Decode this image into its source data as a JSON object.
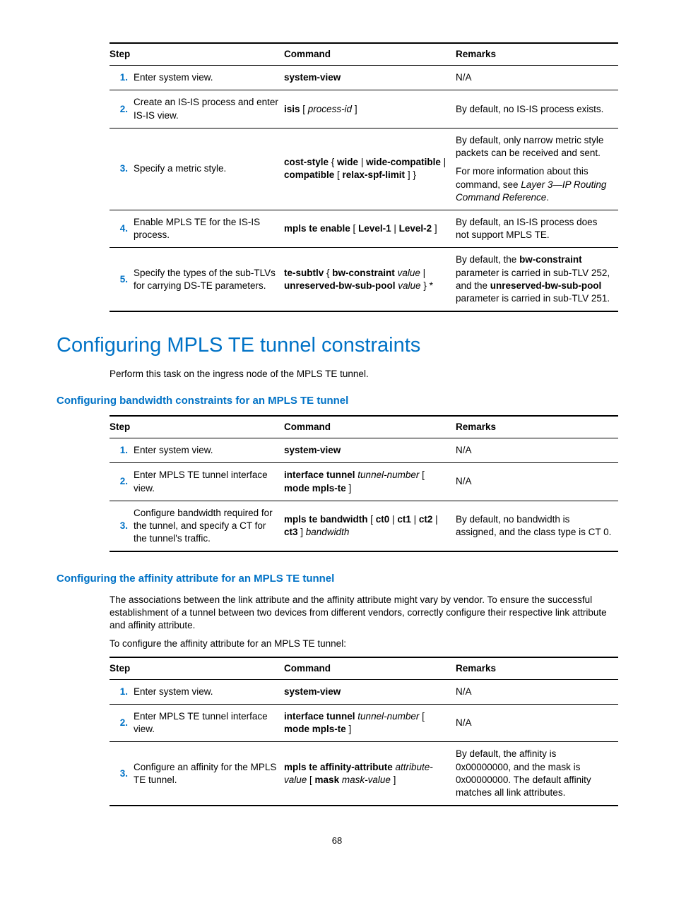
{
  "table1": {
    "headers": {
      "step": "Step",
      "command": "Command",
      "remarks": "Remarks"
    },
    "rows": [
      {
        "num": "1.",
        "step": "Enter system view.",
        "cmd": [
          {
            "t": "b",
            "v": "system-view"
          }
        ],
        "rem": [
          [
            {
              "t": "",
              "v": "N/A"
            }
          ]
        ]
      },
      {
        "num": "2.",
        "step": "Create an IS-IS process and enter IS-IS view.",
        "cmd": [
          {
            "t": "b",
            "v": "isis"
          },
          {
            "t": "",
            "v": " [ "
          },
          {
            "t": "i",
            "v": "process-id"
          },
          {
            "t": "",
            "v": " ]"
          }
        ],
        "rem": [
          [
            {
              "t": "",
              "v": "By default, no IS-IS process exists."
            }
          ]
        ]
      },
      {
        "num": "3.",
        "step": "Specify a metric style.",
        "cmd": [
          {
            "t": "b",
            "v": "cost-style"
          },
          {
            "t": "",
            "v": " { "
          },
          {
            "t": "b",
            "v": "wide"
          },
          {
            "t": "",
            "v": " | "
          },
          {
            "t": "b",
            "v": "wide-compatible"
          },
          {
            "t": "",
            "v": " | "
          },
          {
            "t": "b",
            "v": "compatible"
          },
          {
            "t": "",
            "v": " [ "
          },
          {
            "t": "b",
            "v": "relax-spf-limit"
          },
          {
            "t": "",
            "v": " ] }"
          }
        ],
        "rem": [
          [
            {
              "t": "",
              "v": "By default, only narrow metric style packets can be received and sent."
            }
          ],
          [
            {
              "t": "",
              "v": "For more information about this command, see "
            },
            {
              "t": "i",
              "v": "Layer 3—IP Routing Command Reference"
            },
            {
              "t": "",
              "v": "."
            }
          ]
        ]
      },
      {
        "num": "4.",
        "step": "Enable MPLS TE for the IS-IS process.",
        "cmd": [
          {
            "t": "b",
            "v": "mpls te enable"
          },
          {
            "t": "",
            "v": " [ "
          },
          {
            "t": "b",
            "v": "Level-1"
          },
          {
            "t": "",
            "v": " | "
          },
          {
            "t": "b",
            "v": "Level-2"
          },
          {
            "t": "",
            "v": " ]"
          }
        ],
        "rem": [
          [
            {
              "t": "",
              "v": "By default, an IS-IS process does not support MPLS TE."
            }
          ]
        ]
      },
      {
        "num": "5.",
        "step": "Specify the types of the sub-TLVs for carrying DS-TE parameters.",
        "cmd": [
          {
            "t": "b",
            "v": "te-subtlv"
          },
          {
            "t": "",
            "v": " { "
          },
          {
            "t": "b",
            "v": "bw-constraint"
          },
          {
            "t": "",
            "v": " "
          },
          {
            "t": "i",
            "v": "value"
          },
          {
            "t": "",
            "v": " | "
          },
          {
            "t": "b",
            "v": "unreserved-bw-sub-pool"
          },
          {
            "t": "",
            "v": " "
          },
          {
            "t": "i",
            "v": "value"
          },
          {
            "t": "",
            "v": " } *"
          }
        ],
        "rem": [
          [
            {
              "t": "",
              "v": "By default, the "
            },
            {
              "t": "b",
              "v": "bw-constraint"
            },
            {
              "t": "",
              "v": " parameter is carried in sub-TLV 252, and the "
            },
            {
              "t": "b",
              "v": "unreserved-bw-sub-pool"
            },
            {
              "t": "",
              "v": " parameter is carried in sub-TLV 251."
            }
          ]
        ]
      }
    ]
  },
  "h1": "Configuring MPLS TE tunnel constraints",
  "p1": "Perform this task on the ingress node of the MPLS TE tunnel.",
  "h2a": "Configuring bandwidth constraints for an MPLS TE tunnel",
  "table2": {
    "headers": {
      "step": "Step",
      "command": "Command",
      "remarks": "Remarks"
    },
    "rows": [
      {
        "num": "1.",
        "step": "Enter system view.",
        "cmd": [
          {
            "t": "b",
            "v": "system-view"
          }
        ],
        "rem": [
          [
            {
              "t": "",
              "v": "N/A"
            }
          ]
        ]
      },
      {
        "num": "2.",
        "step": "Enter MPLS TE tunnel interface view.",
        "cmd": [
          {
            "t": "b",
            "v": "interface tunnel"
          },
          {
            "t": "",
            "v": " "
          },
          {
            "t": "i",
            "v": "tunnel-number"
          },
          {
            "t": "",
            "v": " [ "
          },
          {
            "t": "b",
            "v": "mode mpls-te"
          },
          {
            "t": "",
            "v": " ]"
          }
        ],
        "rem": [
          [
            {
              "t": "",
              "v": "N/A"
            }
          ]
        ]
      },
      {
        "num": "3.",
        "step": "Configure bandwidth required for the tunnel, and specify a CT for the tunnel's traffic.",
        "cmd": [
          {
            "t": "b",
            "v": "mpls te bandwidth"
          },
          {
            "t": "",
            "v": " [ "
          },
          {
            "t": "b",
            "v": "ct0"
          },
          {
            "t": "",
            "v": " | "
          },
          {
            "t": "b",
            "v": "ct1"
          },
          {
            "t": "",
            "v": " | "
          },
          {
            "t": "b",
            "v": "ct2"
          },
          {
            "t": "",
            "v": " | "
          },
          {
            "t": "b",
            "v": "ct3"
          },
          {
            "t": "",
            "v": " ] "
          },
          {
            "t": "i",
            "v": "bandwidth"
          }
        ],
        "rem": [
          [
            {
              "t": "",
              "v": "By default, no bandwidth is assigned, and the class type is CT 0."
            }
          ]
        ]
      }
    ]
  },
  "h2b": "Configuring the affinity attribute for an MPLS TE tunnel",
  "p2": "The associations between the link attribute and the affinity attribute might vary by vendor. To ensure the successful establishment of a tunnel between two devices from different vendors, correctly configure their respective link attribute and affinity attribute.",
  "p3": "To configure the affinity attribute for an MPLS TE tunnel:",
  "table3": {
    "headers": {
      "step": "Step",
      "command": "Command",
      "remarks": "Remarks"
    },
    "rows": [
      {
        "num": "1.",
        "step": "Enter system view.",
        "cmd": [
          {
            "t": "b",
            "v": "system-view"
          }
        ],
        "rem": [
          [
            {
              "t": "",
              "v": "N/A"
            }
          ]
        ]
      },
      {
        "num": "2.",
        "step": "Enter MPLS TE tunnel interface view.",
        "cmd": [
          {
            "t": "b",
            "v": "interface tunnel"
          },
          {
            "t": "",
            "v": " "
          },
          {
            "t": "i",
            "v": "tunnel-number"
          },
          {
            "t": "",
            "v": " [ "
          },
          {
            "t": "b",
            "v": "mode mpls-te"
          },
          {
            "t": "",
            "v": " ]"
          }
        ],
        "rem": [
          [
            {
              "t": "",
              "v": "N/A"
            }
          ]
        ]
      },
      {
        "num": "3.",
        "step": "Configure an affinity for the MPLS TE tunnel.",
        "cmd": [
          {
            "t": "b",
            "v": "mpls te affinity-attribute"
          },
          {
            "t": "",
            "v": " "
          },
          {
            "t": "i",
            "v": "attribute-value"
          },
          {
            "t": "",
            "v": " [ "
          },
          {
            "t": "b",
            "v": "mask"
          },
          {
            "t": "",
            "v": " "
          },
          {
            "t": "i",
            "v": "mask-value"
          },
          {
            "t": "",
            "v": " ]"
          }
        ],
        "rem": [
          [
            {
              "t": "",
              "v": "By default, the affinity is 0x00000000, and the mask is 0x00000000. The default affinity matches all link attributes."
            }
          ]
        ]
      }
    ]
  },
  "page": "68"
}
